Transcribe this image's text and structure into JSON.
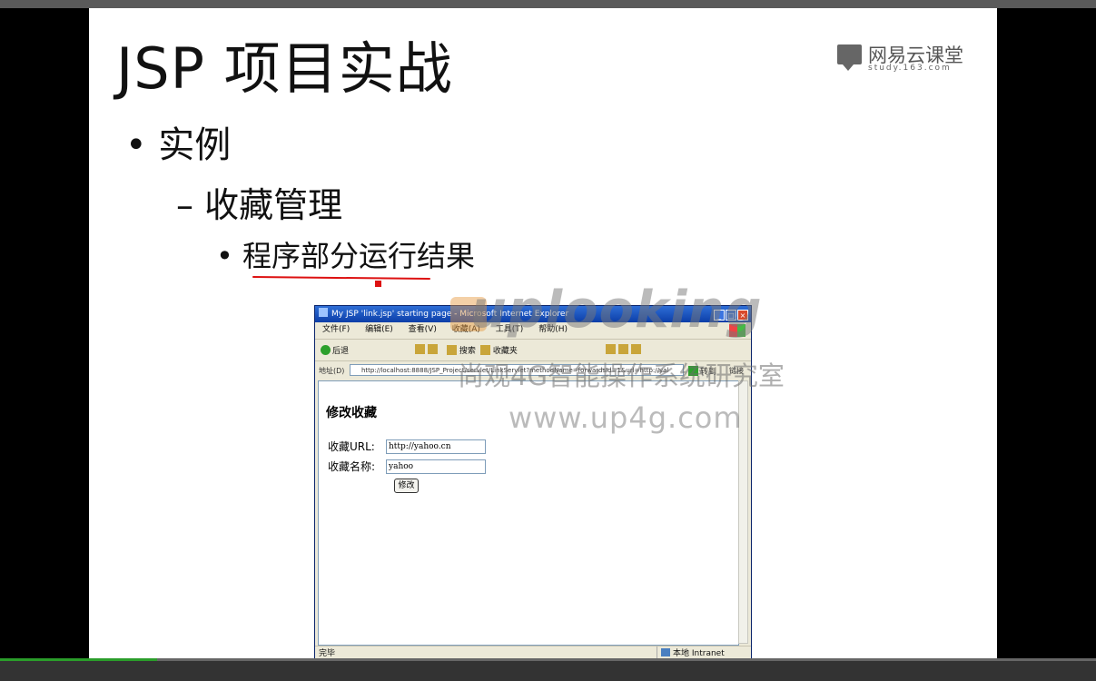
{
  "slide": {
    "title": "JSP 项目实战",
    "brand_name": "网易云课堂",
    "brand_sub": "study.163.com",
    "bullet1": "• 实例",
    "bullet2": "– 收藏管理",
    "bullet3": "• 程序部分运行结果"
  },
  "ie": {
    "title": "My JSP 'link.jsp' starting page - Microsoft Internet Explorer",
    "menu": [
      "文件(F)",
      "编辑(E)",
      "查看(V)",
      "收藏(A)",
      "工具(T)",
      "帮助(H)"
    ],
    "toolbar": {
      "back": "后退",
      "search": "搜索",
      "favorites": "收藏夹"
    },
    "address_label": "地址(D)",
    "address_value": "http://localhost:8888/JSP_Project/servlet/LinkServlet?methodName=forwardsId=1&url=http://yal",
    "go_label": "转到",
    "links_label": "链接",
    "page": {
      "heading": "修改收藏",
      "url_label": "收藏URL:",
      "url_value": "http://yahoo.cn",
      "name_label": "收藏名称:",
      "name_value": "yahoo",
      "submit_label": "修改"
    },
    "status_left": "完毕",
    "status_zone": "本地 Intranet"
  },
  "watermark": {
    "brand": "uplooking",
    "org": "尚观4G智能操作系统研究室",
    "site": "www.up4g.com"
  },
  "video": {
    "progress": 0.143
  }
}
